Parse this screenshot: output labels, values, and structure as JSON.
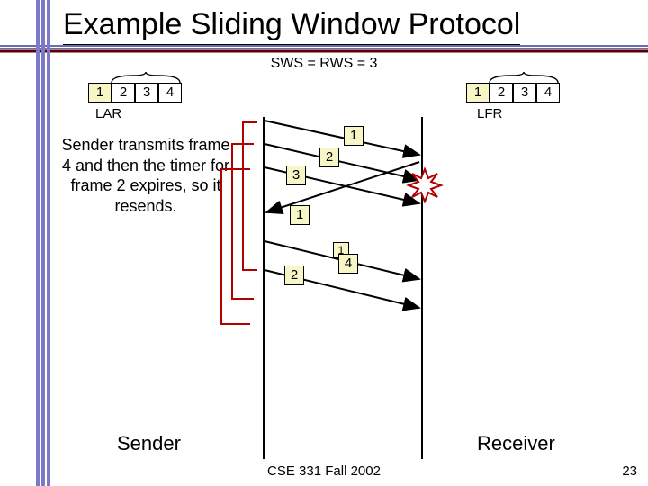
{
  "title": "Example Sliding Window Protocol",
  "subtitle": "SWS = RWS = 3",
  "sender_window": {
    "cells": [
      "1",
      "2",
      "3",
      "4"
    ],
    "label_below": "LAR"
  },
  "receiver_window": {
    "cells": [
      "1",
      "2",
      "3",
      "4"
    ],
    "label_below": "LFR"
  },
  "caption_text": "Sender transmits frame 4 and then the timer for frame 2 expires, so it resends.",
  "packets": {
    "p1": "1",
    "p2": "2",
    "p3": "3",
    "ack1": "1",
    "p4_small": "1",
    "p4": "4",
    "resent2": "2"
  },
  "sender_label": "Sender",
  "receiver_label": "Receiver",
  "footer_text": "CSE 331 Fall 2002",
  "page_number": "23",
  "colors": {
    "rule": "#5b5ba0",
    "dark_rule": "#5a0000"
  }
}
